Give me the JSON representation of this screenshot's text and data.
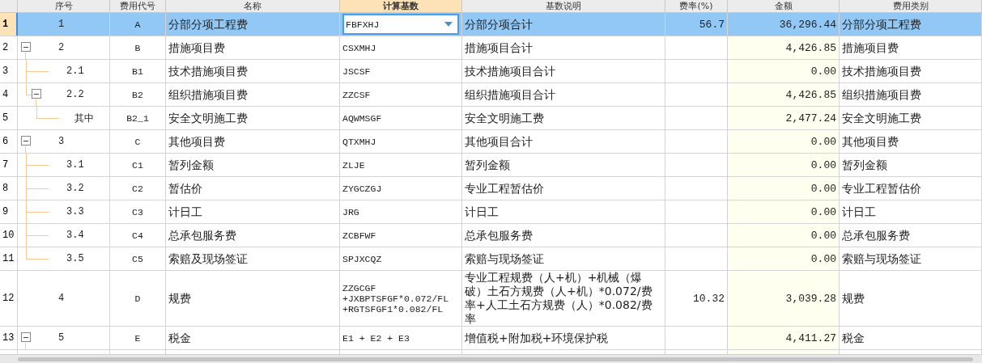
{
  "columns": [
    {
      "label": "序号",
      "selected": false
    },
    {
      "label": "费用代号",
      "selected": false
    },
    {
      "label": "名称",
      "selected": false
    },
    {
      "label": "计算基数",
      "selected": true
    },
    {
      "label": "基数说明",
      "selected": false
    },
    {
      "label": "费率(%)",
      "selected": false
    },
    {
      "label": "金额",
      "selected": false
    },
    {
      "label": "费用类别",
      "selected": false
    }
  ],
  "rows": [
    {
      "row_number": "1",
      "seq": "1",
      "code": "A",
      "name": "分部分项工程费",
      "base": "FBFXHJ",
      "base_desc": "分部分项合计",
      "rate": "56.7",
      "amount": "36,296.44",
      "category": "分部分项工程费",
      "selected": true
    },
    {
      "row_number": "2",
      "seq": "2",
      "code": "B",
      "name": "措施项目费",
      "base": "CSXMHJ",
      "base_desc": "措施项目合计",
      "amount": "4,426.85",
      "category": "措施项目费",
      "selected": false,
      "expanded": true,
      "children": [
        {
          "row_number": "3",
          "seq": "2.1",
          "code": "B1",
          "name": "技术措施项目费",
          "base": "JSCSF",
          "base_desc": "技术措施项目合计",
          "amount": "0.00",
          "category": "技术措施项目费",
          "selected": false
        },
        {
          "row_number": "4",
          "seq": "2.2",
          "code": "B2",
          "name": "组织措施项目费",
          "base": "ZZCSF",
          "base_desc": "组织措施项目合计",
          "amount": "4,426.85",
          "category": "组织措施项目费",
          "selected": false,
          "expanded": true,
          "children": [
            {
              "row_number": "5",
              "seq": "其中",
              "code": "B2_1",
              "name": "安全文明施工费",
              "base": "AQWMSGF",
              "base_desc": "安全文明施工费",
              "amount": "2,477.24",
              "category": "安全文明施工费",
              "selected": false
            }
          ]
        }
      ]
    },
    {
      "row_number": "6",
      "seq": "3",
      "code": "C",
      "name": "其他项目费",
      "base": "QTXMHJ",
      "base_desc": "其他项目合计",
      "amount": "0.00",
      "category": "其他项目费",
      "selected": false,
      "expanded": true,
      "children": [
        {
          "row_number": "7",
          "seq": "3.1",
          "code": "C1",
          "name": "暂列金额",
          "base": "ZLJE",
          "base_desc": "暂列金额",
          "amount": "0.00",
          "category": "暂列金额",
          "selected": false
        },
        {
          "row_number": "8",
          "seq": "3.2",
          "code": "C2",
          "name": "暂估价",
          "base": "ZYGCZGJ",
          "base_desc": "专业工程暂估价",
          "amount": "0.00",
          "category": "专业工程暂估价",
          "selected": false
        },
        {
          "row_number": "9",
          "seq": "3.3",
          "code": "C3",
          "name": "计日工",
          "base": "JRG",
          "base_desc": "计日工",
          "amount": "0.00",
          "category": "计日工",
          "selected": false
        },
        {
          "row_number": "10",
          "seq": "3.4",
          "code": "C4",
          "name": "总承包服务费",
          "base": "ZCBFWF",
          "base_desc": "总承包服务费",
          "amount": "0.00",
          "category": "总承包服务费",
          "selected": false
        },
        {
          "row_number": "11",
          "seq": "3.5",
          "code": "C5",
          "name": "索赔及现场签证",
          "base": "SPJXCQZ",
          "base_desc": "索赔与现场签证",
          "amount": "0.00",
          "category": "索赔与现场签证",
          "selected": false
        }
      ]
    },
    {
      "row_number": "12",
      "seq": "4",
      "code": "D",
      "name": "规费",
      "base": "ZZGCGF +JXBPTSFGF*0.072/FL +RGTSFGF1*0.082/FL",
      "base_desc": "专业工程规费（人+机）+机械（爆破）土石方规费（人+机）*0.072/费率+人工土石方规费（人）*0.082/费率",
      "rate": "10.32",
      "amount": "3,039.28",
      "category": "规费",
      "selected": false
    },
    {
      "row_number": "13",
      "seq": "5",
      "code": "E",
      "name": "税金",
      "base": "E1 + E2 + E3",
      "base_desc": "增值税+附加税+环境保护税",
      "amount": "4,411.27",
      "category": "税金",
      "selected": false,
      "expanded": true
    }
  ]
}
